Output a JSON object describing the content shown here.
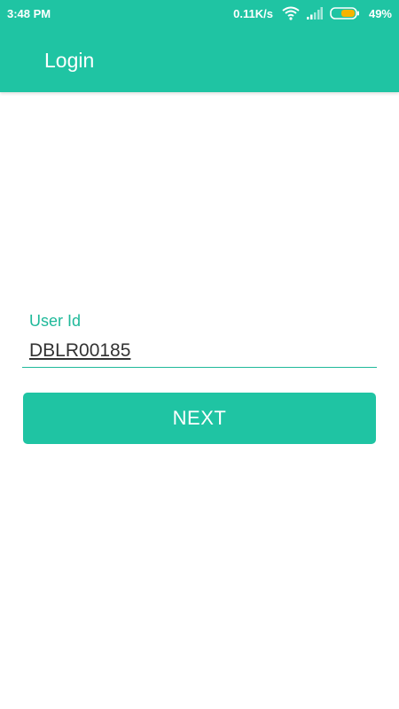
{
  "status_bar": {
    "time": "3:48 PM",
    "network_speed": "0.11K/s",
    "battery_percent": "49%",
    "icons": [
      "wifi-icon",
      "signal-icon",
      "battery-icon"
    ]
  },
  "app_bar": {
    "title": "Login"
  },
  "login_form": {
    "user_id_label": "User Id",
    "user_id_value": "DBLR00185",
    "next_label": "NEXT"
  },
  "colors": {
    "accent": "#1fc4a3",
    "label": "#1fb99a",
    "battery_fill": "#f5b400",
    "text": "#333333"
  }
}
